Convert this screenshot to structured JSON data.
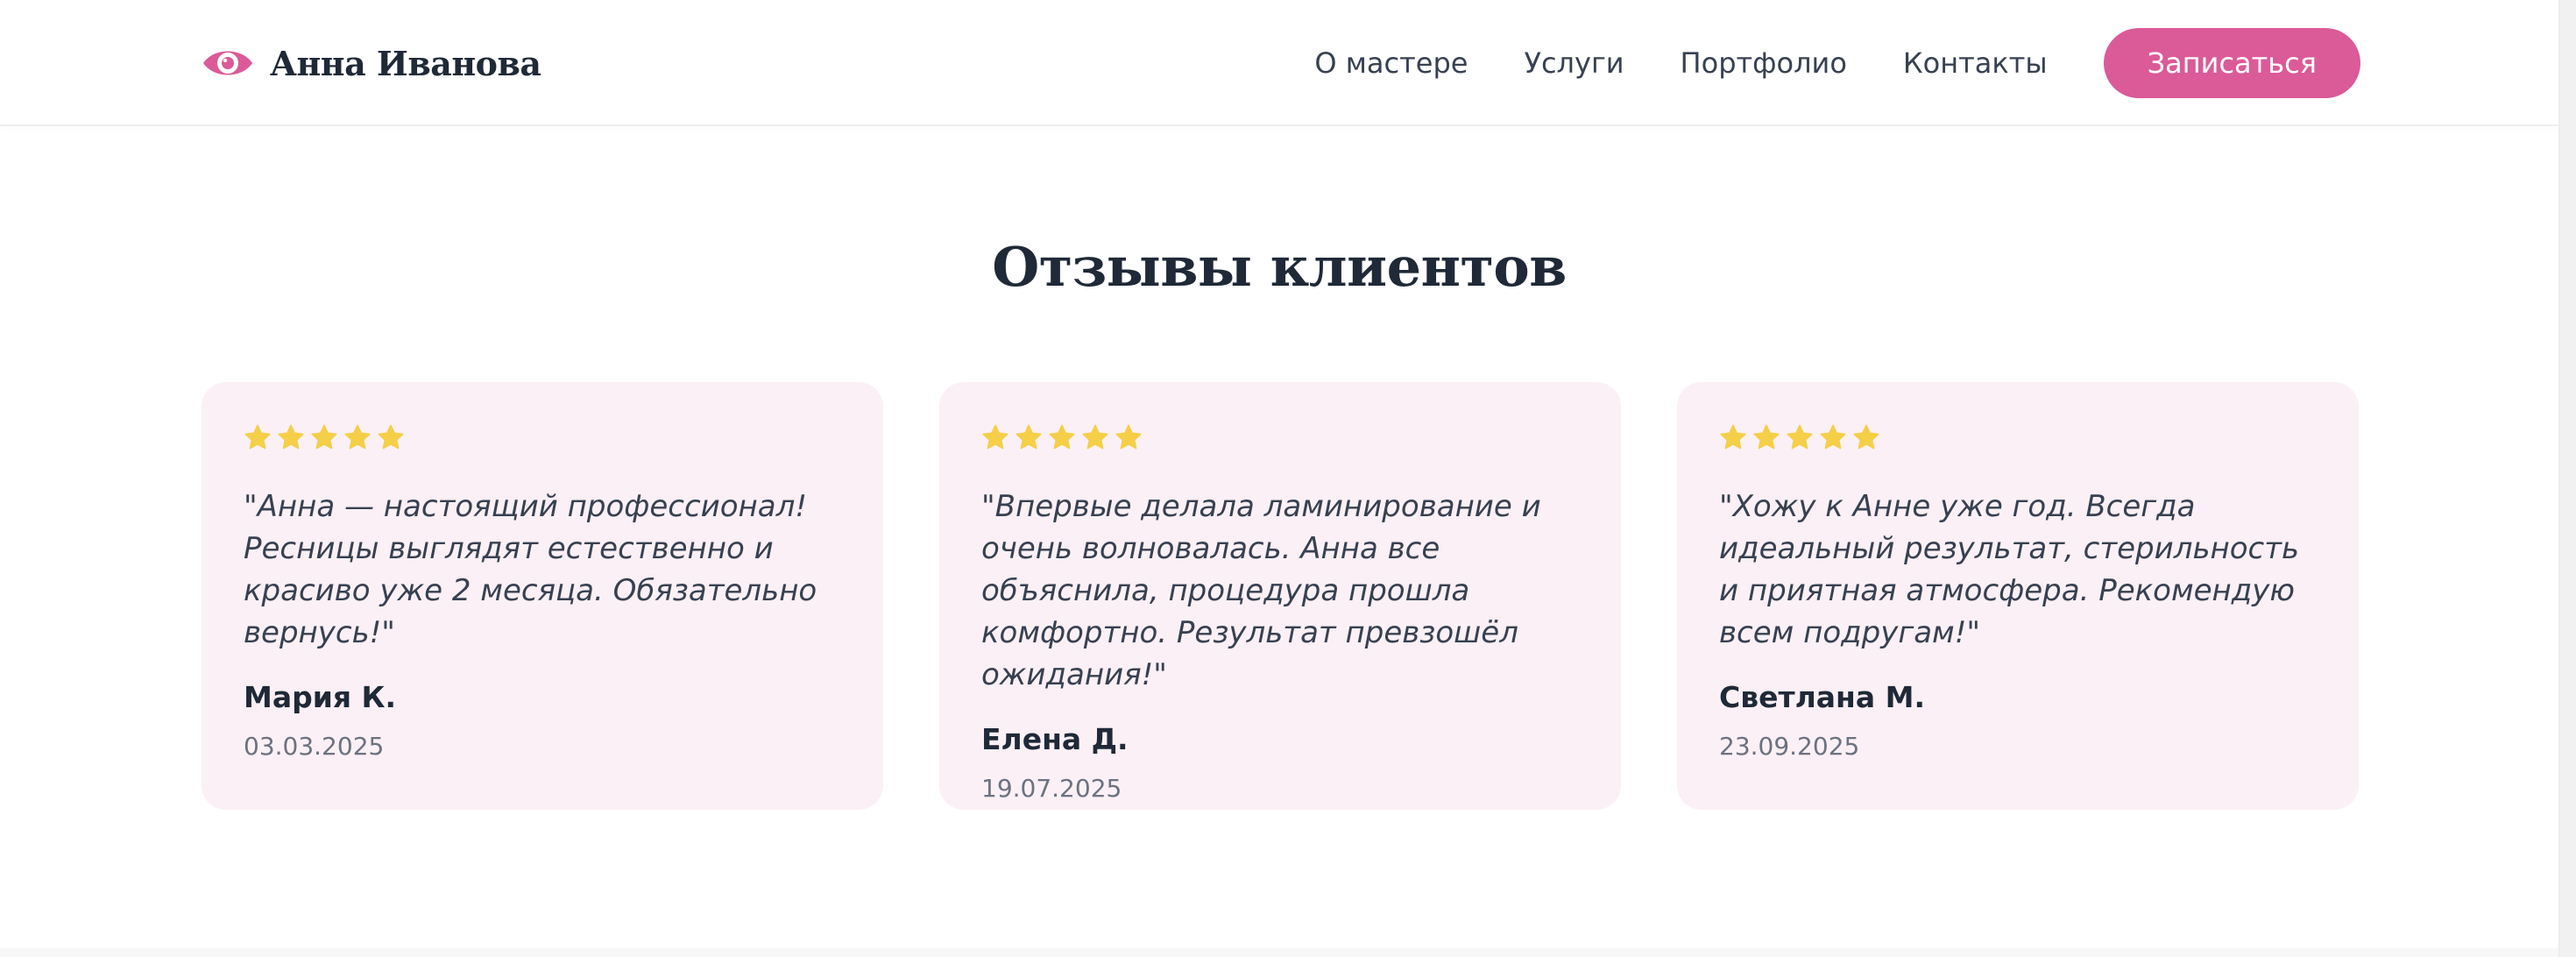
{
  "header": {
    "logo_text": "Анна Иванова",
    "logo_icon": "eye-icon",
    "nav": [
      "О мастере",
      "Услуги",
      "Портфолио",
      "Контакты"
    ],
    "cta_label": "Записаться"
  },
  "reviews": {
    "title": "Отзывы клиентов",
    "items": [
      {
        "rating": 5,
        "text": "\"Анна — настоящий профессионал! Ресницы выглядят естественно и красиво уже 2 месяца. Обязательно вернусь!\"",
        "author": "Мария К.",
        "date": "03.03.2025"
      },
      {
        "rating": 5,
        "text": "\"Впервые делала ламинирование и очень волновалась. Анна все объяснила, процедура прошла комфортно. Результат превзошёл ожидания!\"",
        "author": "Елена Д.",
        "date": "19.07.2025"
      },
      {
        "rating": 5,
        "text": "\"Хожу к Анне уже год. Всегда идеальный результат, стерильность и приятная атмосфера. Рекомендую всем подругам!\"",
        "author": "Светлана М.",
        "date": "23.09.2025"
      }
    ]
  },
  "colors": {
    "accent": "#db5a98",
    "card_bg": "#fbf0f5",
    "star": "#f5cf48",
    "text_dark": "#1f2937",
    "text_muted": "#6b7280"
  }
}
